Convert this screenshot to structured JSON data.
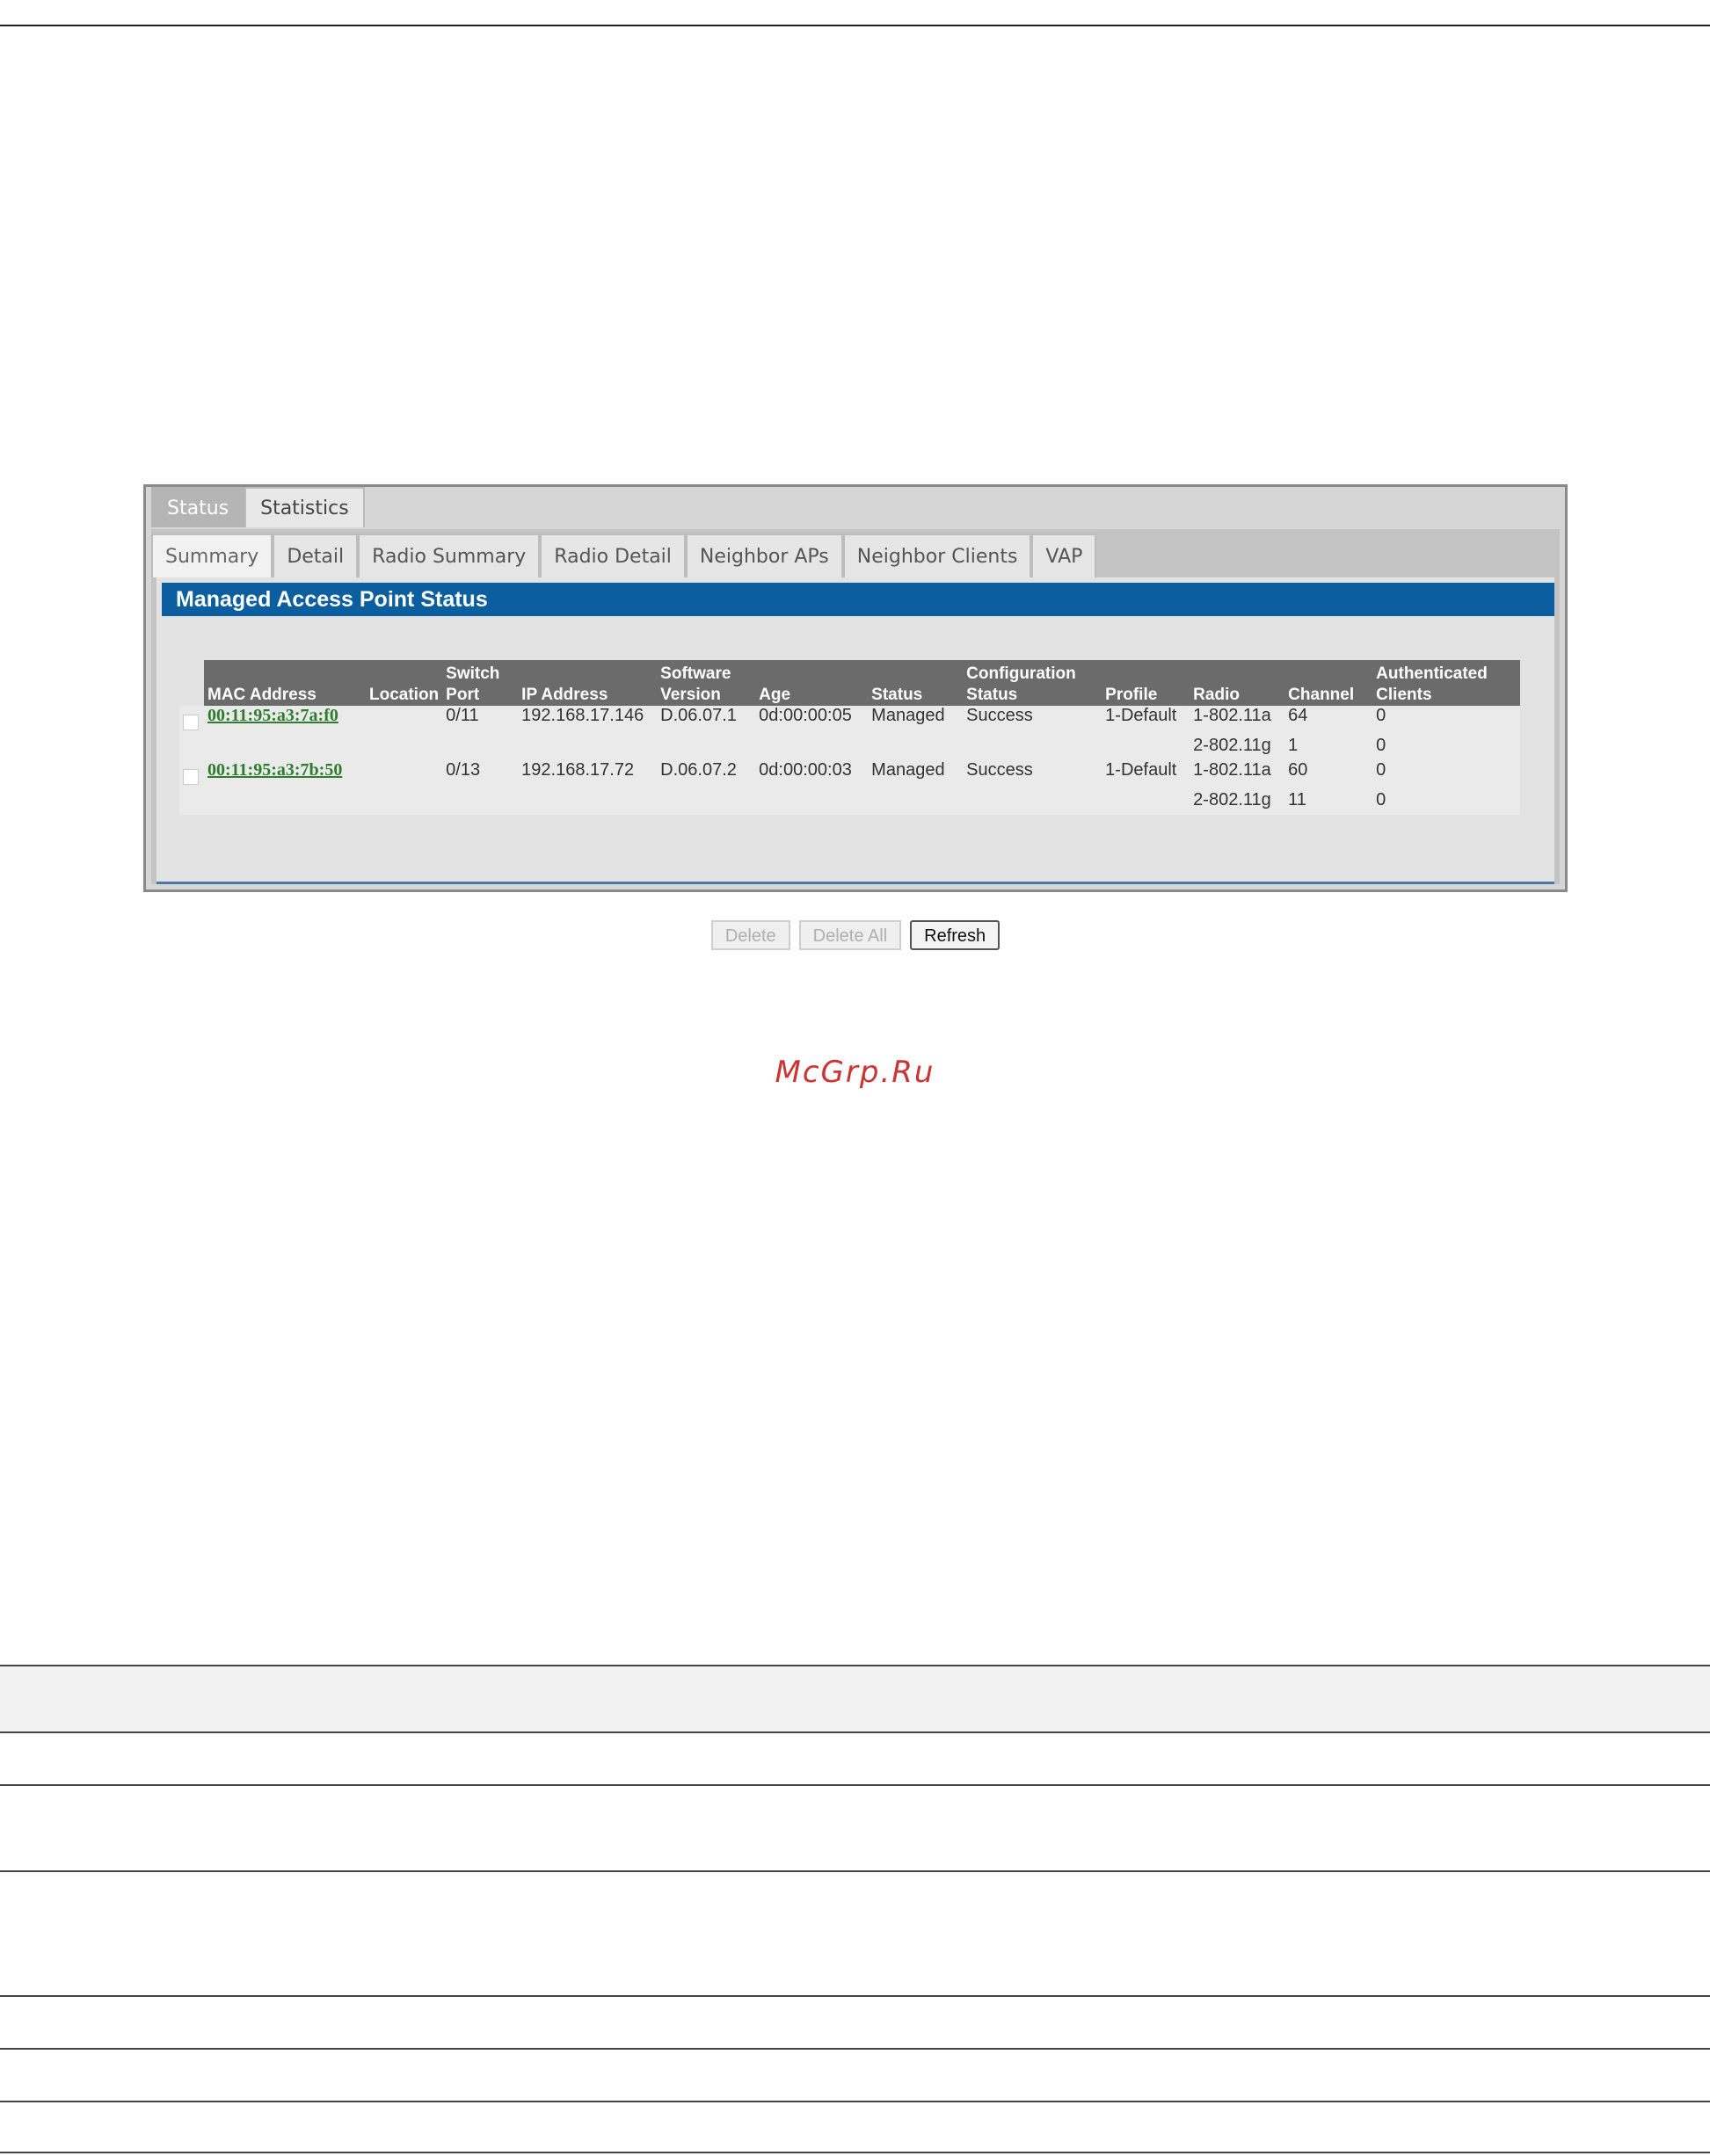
{
  "tabs_level1": [
    "Status",
    "Statistics"
  ],
  "tabs_level2": [
    "Summary",
    "Detail",
    "Radio Summary",
    "Radio Detail",
    "Neighbor APs",
    "Neighbor Clients",
    "VAP"
  ],
  "panel_title": "Managed Access Point Status",
  "columns": {
    "mac": "MAC Address",
    "location": "Location",
    "port_1": "Switch",
    "port_2": "Port",
    "ip": "IP Address",
    "ver_1": "Software",
    "ver_2": "Version",
    "age": "Age",
    "status": "Status",
    "cfg_1": "Configuration",
    "cfg_2": "Status",
    "profile": "Profile",
    "radio": "Radio",
    "channel": "Channel",
    "auth_1": "Authenticated",
    "auth_2": "Clients"
  },
  "rows": [
    {
      "mac": "00:11:95:a3:7a:f0",
      "location": "",
      "port": "0/11",
      "ip": "192.168.17.146",
      "version": "D.06.07.1",
      "age": "0d:00:00:05",
      "status": "Managed",
      "config_status": "Success",
      "profile": "1-Default",
      "radio1": "1-802.11a",
      "channel1": "64",
      "clients1": "0",
      "radio2": "2-802.11g",
      "channel2": "1",
      "clients2": "0"
    },
    {
      "mac": "00:11:95:a3:7b:50",
      "location": "",
      "port": "0/13",
      "ip": "192.168.17.72",
      "version": "D.06.07.2",
      "age": "0d:00:00:03",
      "status": "Managed",
      "config_status": "Success",
      "profile": "1-Default",
      "radio1": "1-802.11a",
      "channel1": "60",
      "clients1": "0",
      "radio2": "2-802.11g",
      "channel2": "11",
      "clients2": "0"
    }
  ],
  "buttons": {
    "delete": "Delete",
    "delete_all": "Delete All",
    "refresh": "Refresh"
  },
  "watermark": "McGrp.Ru"
}
